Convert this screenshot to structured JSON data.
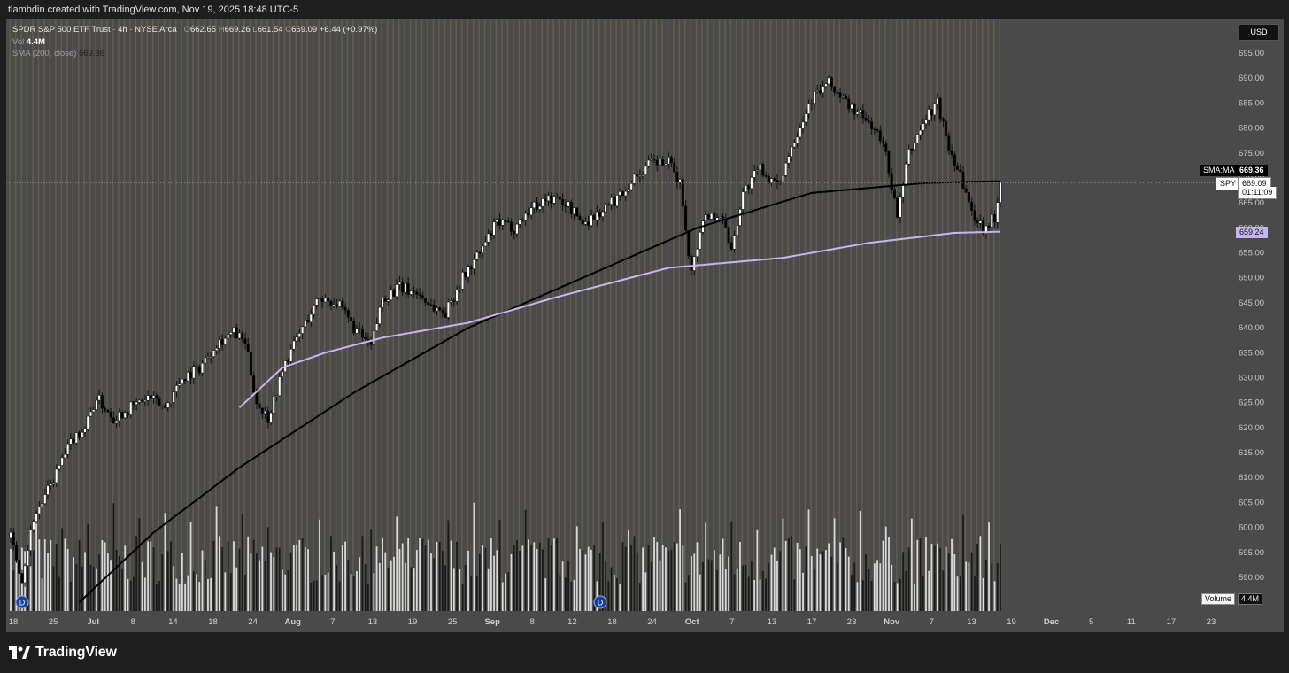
{
  "header": {
    "attribution": "tlambdin created with TradingView.com, Nov 19, 2025 18:48 UTC-5"
  },
  "legend": {
    "symbol_name": "SPDR S&P 500 ETF Trust · 4h · NYSE Arca",
    "ohlc": {
      "o_label": "O",
      "o": "662.65",
      "h_label": "H",
      "h": "669.26",
      "l_label": "L",
      "l": "661.54",
      "c_label": "C",
      "c": "669.09",
      "change": "+6.44 (+0.97%)"
    },
    "vol_label": "Vol",
    "vol_value": "4.4M",
    "sma_label": "SMA (200, close)",
    "sma_value": "669.36"
  },
  "currency_button": "USD",
  "price_labels": {
    "sma_tag": "SMA:MA",
    "sma_value": "669.36",
    "symbol_tag": "SPY",
    "last_price": "669.09",
    "countdown": "01:11:09",
    "vwap_value": "659.24"
  },
  "volume_label": {
    "name": "Volume",
    "value": "4.4M"
  },
  "footer": {
    "brand": "TradingView"
  },
  "colors": {
    "background": "#4a4a4a",
    "stripe": "#6b6150",
    "black_ma": "#000000",
    "purple_ma": "#c6b6ef",
    "candle_up": "#ffffff",
    "candle_down": "#000000"
  },
  "chart_data": {
    "type": "candlestick",
    "title": "SPDR S&P 500 ETF Trust · 4h · NYSE Arca",
    "y_axis": {
      "min": 585,
      "max": 697.5,
      "ticks": [
        590,
        595,
        600,
        605,
        610,
        615,
        620,
        625,
        630,
        635,
        640,
        645,
        650,
        655,
        660,
        665,
        670,
        675,
        680,
        685,
        690,
        695
      ]
    },
    "x_axis_ticks": [
      "18",
      "25",
      "Jul",
      "8",
      "14",
      "18",
      "24",
      "Aug",
      "7",
      "13",
      "19",
      "25",
      "Sep",
      "8",
      "12",
      "18",
      "24",
      "Oct",
      "7",
      "13",
      "17",
      "23",
      "Nov",
      "7",
      "13",
      "19",
      "Dec",
      "5",
      "11",
      "17",
      "23"
    ],
    "price_keypoints": [
      [
        0,
        598
      ],
      [
        4,
        590
      ],
      [
        8,
        602
      ],
      [
        12,
        606
      ],
      [
        16,
        611
      ],
      [
        22,
        618
      ],
      [
        26,
        620
      ],
      [
        30,
        626
      ],
      [
        36,
        622
      ],
      [
        42,
        624
      ],
      [
        48,
        626
      ],
      [
        54,
        624
      ],
      [
        60,
        630
      ],
      [
        66,
        632
      ],
      [
        72,
        637
      ],
      [
        78,
        639
      ],
      [
        82,
        637
      ],
      [
        86,
        625
      ],
      [
        90,
        622
      ],
      [
        96,
        633
      ],
      [
        102,
        640
      ],
      [
        108,
        646
      ],
      [
        114,
        645
      ],
      [
        120,
        640
      ],
      [
        126,
        636
      ],
      [
        130,
        646
      ],
      [
        136,
        648
      ],
      [
        142,
        647
      ],
      [
        148,
        644
      ],
      [
        152,
        643
      ],
      [
        158,
        650
      ],
      [
        164,
        655
      ],
      [
        170,
        661
      ],
      [
        176,
        660
      ],
      [
        182,
        664
      ],
      [
        188,
        666
      ],
      [
        194,
        665
      ],
      [
        200,
        661
      ],
      [
        206,
        663
      ],
      [
        212,
        666
      ],
      [
        218,
        670
      ],
      [
        224,
        673
      ],
      [
        230,
        673
      ],
      [
        234,
        669
      ],
      [
        238,
        651
      ],
      [
        242,
        662
      ],
      [
        248,
        663
      ],
      [
        252,
        656
      ],
      [
        256,
        667
      ],
      [
        262,
        672
      ],
      [
        268,
        668
      ],
      [
        274,
        678
      ],
      [
        280,
        686
      ],
      [
        286,
        689
      ],
      [
        292,
        685
      ],
      [
        298,
        682
      ],
      [
        302,
        680
      ],
      [
        306,
        675
      ],
      [
        310,
        662
      ],
      [
        314,
        675
      ],
      [
        320,
        682
      ],
      [
        324,
        685
      ],
      [
        328,
        676
      ],
      [
        332,
        671
      ],
      [
        336,
        663
      ],
      [
        340,
        660
      ],
      [
        344,
        662
      ],
      [
        346,
        669.09
      ]
    ],
    "total_bars": 347,
    "sma_200_black": {
      "name": "SMA (200, close)",
      "keypoints": [
        [
          24,
          585
        ],
        [
          50,
          599
        ],
        [
          80,
          612
        ],
        [
          120,
          627
        ],
        [
          160,
          640
        ],
        [
          200,
          650
        ],
        [
          240,
          660
        ],
        [
          280,
          667
        ],
        [
          320,
          669
        ],
        [
          346,
          669.36
        ]
      ]
    },
    "purple_ma": {
      "value_last": 659.24,
      "keypoints": [
        [
          80,
          624
        ],
        [
          95,
          632
        ],
        [
          110,
          635
        ],
        [
          130,
          638
        ],
        [
          160,
          641
        ],
        [
          190,
          646
        ],
        [
          230,
          652
        ],
        [
          270,
          654
        ],
        [
          300,
          657
        ],
        [
          330,
          659
        ],
        [
          346,
          659.24
        ]
      ]
    },
    "volume": {
      "last": "4.4M"
    }
  }
}
